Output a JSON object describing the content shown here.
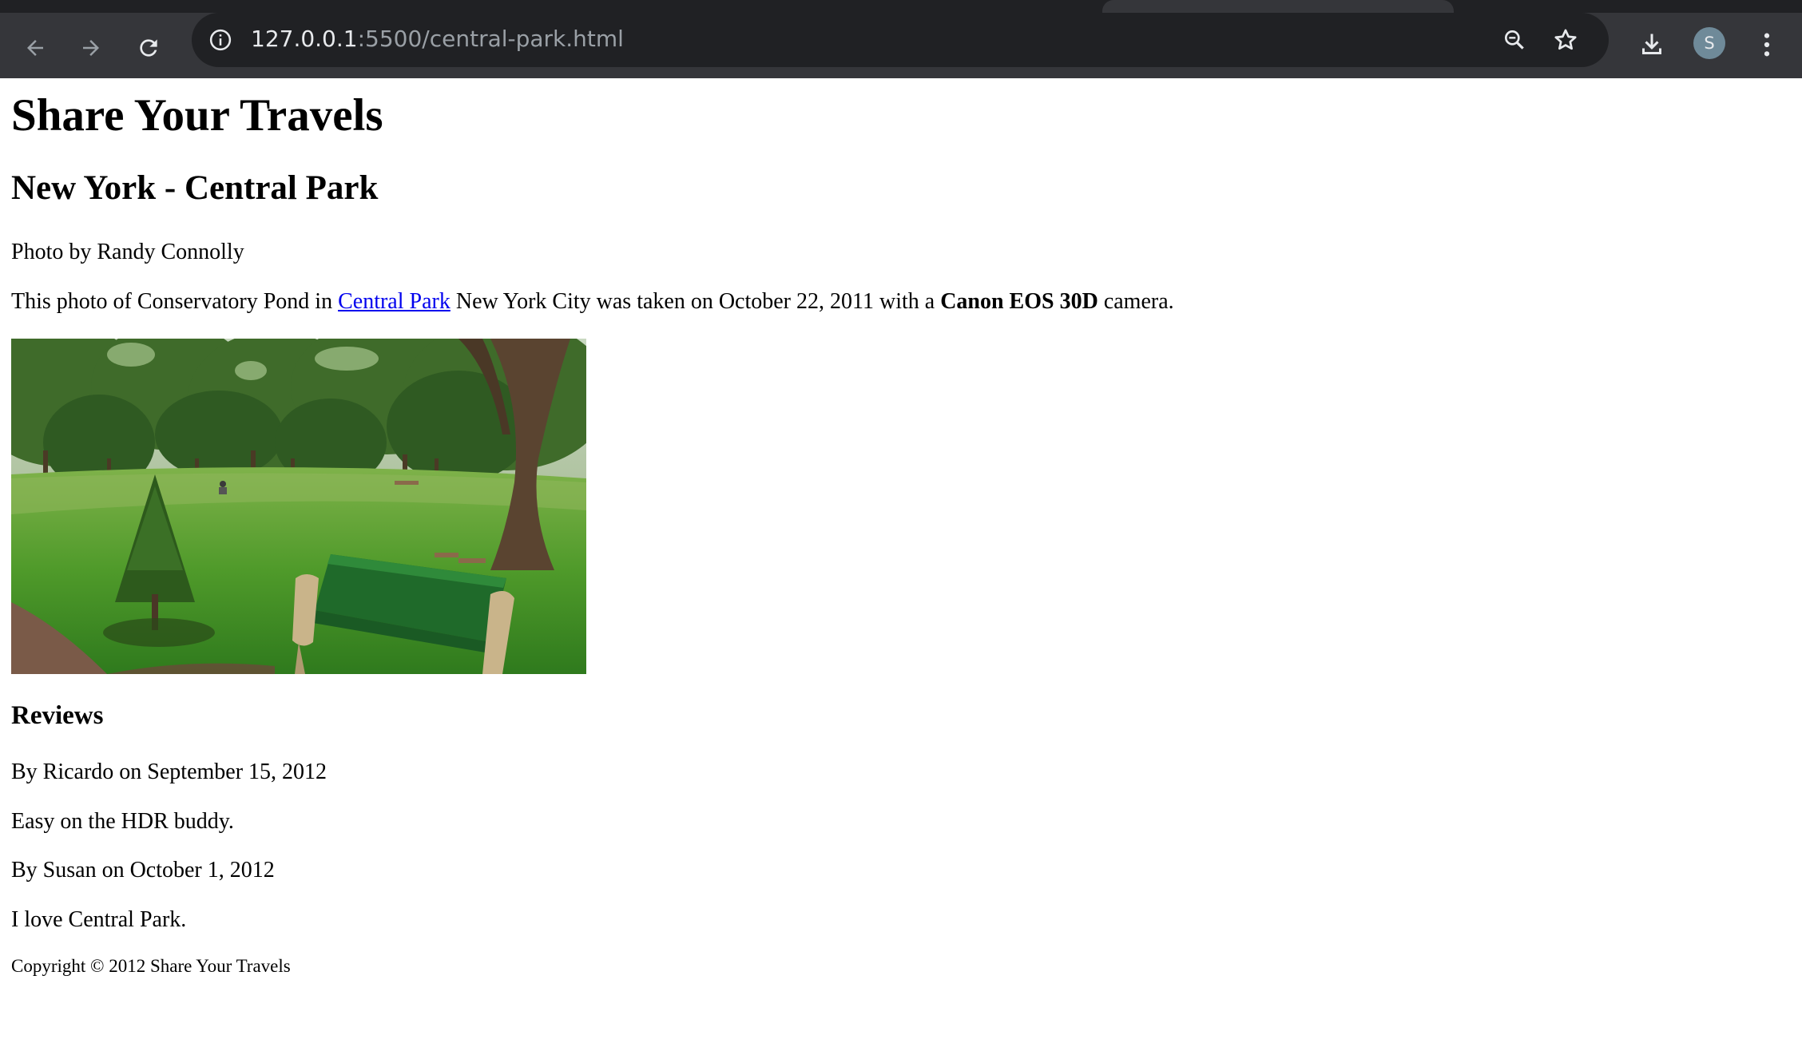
{
  "browser": {
    "url_host": "127.0.0.1",
    "url_path": ":5500/central-park.html",
    "profile_initial": "S",
    "icons": {
      "back": "arrow-left-icon",
      "forward": "arrow-right-icon",
      "reload": "reload-icon",
      "site_info": "info-icon",
      "zoom": "zoom-icon",
      "bookmark": "star-icon",
      "downloads": "download-icon",
      "menu": "kebab-menu-icon"
    },
    "colors": {
      "toolbar": "#35363a",
      "omnibox": "#202124",
      "avatar": "#6f8a99"
    }
  },
  "page": {
    "site_title": "Share Your Travels",
    "photo_title": "New York - Central Park",
    "photo_credit": "Photo by Randy Connolly",
    "description": {
      "before_link": "This photo of Conservatory Pond in ",
      "link_text": "Central Park",
      "middle": " New York City was taken on October 22, 2011 with a ",
      "camera": "Canon EOS 30D",
      "after": " camera."
    },
    "reviews_title": "Reviews",
    "reviews": [
      {
        "byline": "By Ricardo on September 15, 2012",
        "text": "Easy on the HDR buddy."
      },
      {
        "byline": "By Susan on October 1, 2012",
        "text": "I love Central Park."
      }
    ],
    "copyright": "Copyright © 2012 Share Your Travels",
    "link_color": "#0000ee"
  }
}
